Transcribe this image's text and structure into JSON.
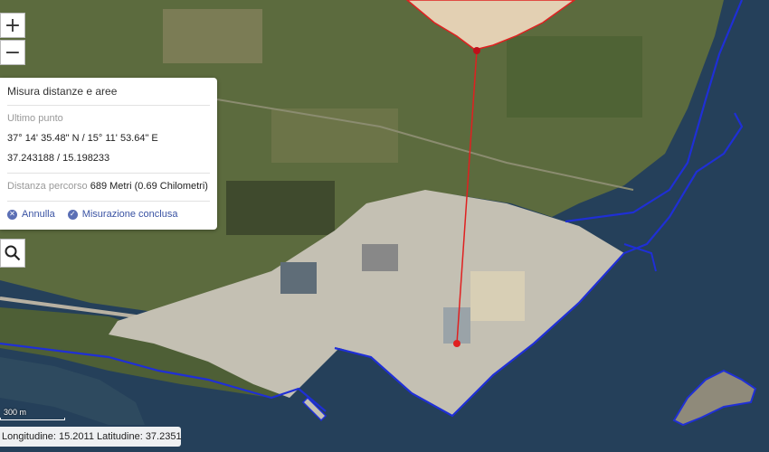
{
  "map": {
    "colors": {
      "sea": "#25405a",
      "land": "#5a6b3c",
      "port": "#c9c4b6",
      "coastline": "#1f2fd6",
      "measure_line": "#e02020",
      "area_fill": "#f2dcc0"
    }
  },
  "controls": {
    "zoom_in_label": "+",
    "zoom_out_label": "−",
    "search_icon": "magnifier-icon"
  },
  "measure_panel": {
    "title": "Misura distanze e aree",
    "last_point_label": "Ultimo punto",
    "last_point_dms": "37° 14' 35.48\" N / 15° 11' 53.64\" E",
    "last_point_decimal": "37.243188 / 15.198233",
    "distance_label": "Distanza percorso",
    "distance_value": "689 Metri (0.69 Chilometri)",
    "cancel_label": "Annulla",
    "finish_label": "Misurazione conclusa"
  },
  "scale": {
    "label": "300 m"
  },
  "coords": {
    "text": "Longitudine: 15.2011 Latitudine: 37.2351"
  }
}
